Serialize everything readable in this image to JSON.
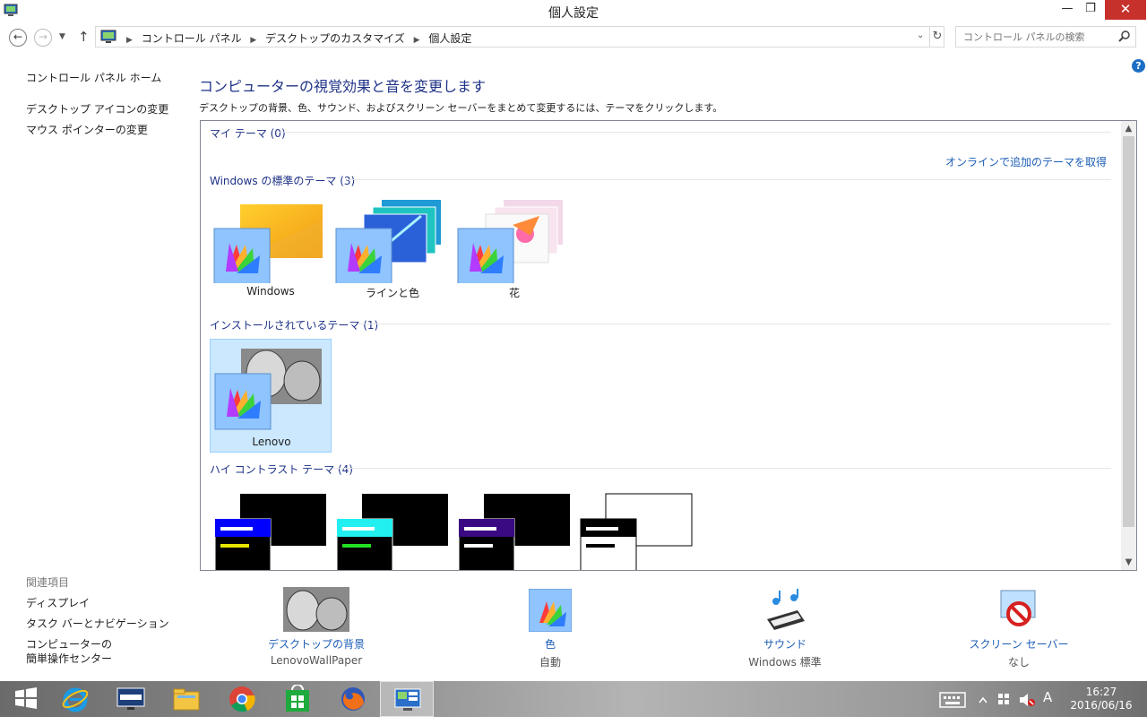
{
  "window": {
    "title": "個人設定"
  },
  "address": {
    "crumbs": [
      "コントロール パネル",
      "デスクトップのカスタマイズ",
      "個人設定"
    ],
    "search_placeholder": "コントロール パネルの検索"
  },
  "leftnav": {
    "home": "コントロール パネル ホーム",
    "items": [
      "デスクトップ アイコンの変更",
      "マウス ポインターの変更"
    ]
  },
  "related": {
    "heading": "関連項目",
    "items": [
      "ディスプレイ",
      "タスク バーとナビゲーション",
      "コンピューターの",
      "簡単操作センター"
    ]
  },
  "main": {
    "heading": "コンピューターの視覚効果と音を変更します",
    "subtitle": "デスクトップの背景、色、サウンド、およびスクリーン セーバーをまとめて変更するには、テーマをクリックします。",
    "online_link": "オンラインで追加のテーマを取得",
    "sections": {
      "my": "マイ テーマ (0)",
      "windows": "Windows の標準のテーマ (3)",
      "installed": "インストールされているテーマ (1)",
      "highcontrast": "ハイ コントラスト テーマ (4)"
    },
    "windows_themes": [
      "Windows",
      "ラインと色",
      "花"
    ],
    "installed_themes": [
      "Lenovo"
    ]
  },
  "bottom": [
    {
      "link": "デスクトップの背景",
      "value": "LenovoWallPaper"
    },
    {
      "link": "色",
      "value": "自動"
    },
    {
      "link": "サウンド",
      "value": "Windows 標準"
    },
    {
      "link": "スクリーン セーバー",
      "value": "なし"
    }
  ],
  "taskbar": {
    "time": "16:27",
    "date": "2016/06/16",
    "ime": "A"
  },
  "colors": {
    "accent_link": "#1c5db5",
    "heading": "#1e3287",
    "close": "#c7312b",
    "selection": "#cce8ff"
  }
}
